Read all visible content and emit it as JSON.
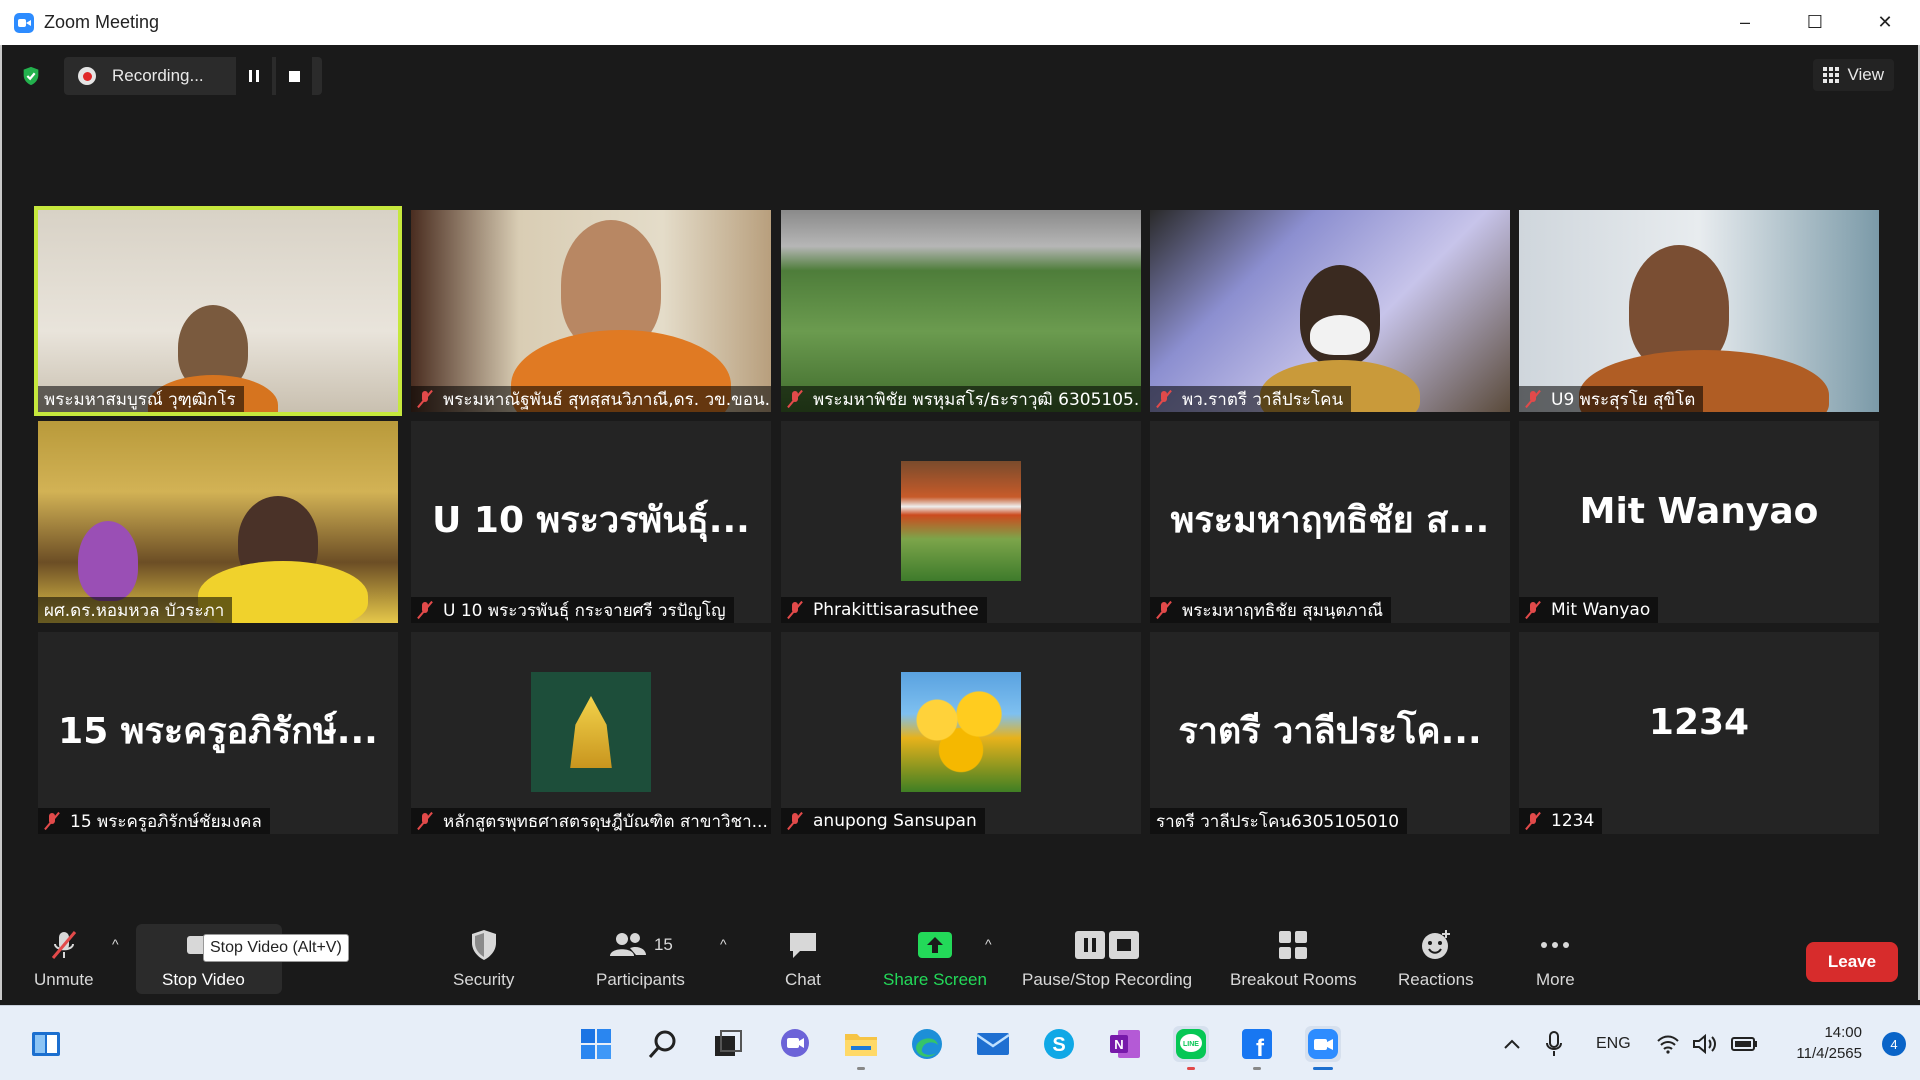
{
  "window": {
    "title": "Zoom Meeting",
    "controls": [
      "–",
      "☐",
      "✕"
    ]
  },
  "meeting_bar": {
    "recording_label": "Recording...",
    "view_label": "View"
  },
  "tiles": [
    {
      "big": "",
      "name": "พระมหาสมบูรณ์ วุฑฺฒิกโร",
      "muted": false
    },
    {
      "big": "",
      "name": "พระมหาณัฐพันธ์ สุทสฺสนวิภาณี,ดร. วข.ขอน...",
      "muted": true
    },
    {
      "big": "",
      "name": "พระมหาพิชัย พรหุมสโร/ธะราวุฒิ 6305105...",
      "muted": true
    },
    {
      "big": "",
      "name": "พว.ราตรี วาลีประโคน",
      "muted": true
    },
    {
      "big": "",
      "name": "U9 พระสุรโย สุขิโต",
      "muted": true
    },
    {
      "big": "",
      "name": "ผศ.ดร.หอมหวล บัวระภา",
      "muted": false
    },
    {
      "big": "U 10 พระวรพันธุ์...",
      "name": "U 10 พระวรพันธุ์ กระจายศรี วรปัญโญ",
      "muted": true
    },
    {
      "big": "",
      "name": "Phrakittisarasuthee",
      "muted": true
    },
    {
      "big": "พระมหาฤทธิชัย ส...",
      "name": "พระมหาฤทธิชัย สุมนฺตภาณี",
      "muted": true
    },
    {
      "big": "Mit Wanyao",
      "name": "Mit Wanyao",
      "muted": true
    },
    {
      "big": "15 พระครูอภิรักษ์...",
      "name": "15 พระครูอภิรักษ์ชัยมงคล",
      "muted": true
    },
    {
      "big": "",
      "name": "หลักสูตรพุทธศาสตรดุษฎีบัณฑิต สาขาวิชา...",
      "muted": true
    },
    {
      "big": "",
      "name": "anupong Sansupan",
      "muted": true
    },
    {
      "big": "ราตรี วาลีประโค...",
      "name": "ราตรี วาลีประโคน6305105010",
      "muted": false
    },
    {
      "big": "1234",
      "name": "1234",
      "muted": true
    }
  ],
  "toolbar": {
    "unmute": "Unmute",
    "stop_video": "Stop Video",
    "tooltip": "Stop Video (Alt+V)",
    "security": "Security",
    "participants": "Participants",
    "participants_count": "15",
    "chat": "Chat",
    "share_screen": "Share Screen",
    "pause_stop_recording": "Pause/Stop Recording",
    "breakout_rooms": "Breakout Rooms",
    "reactions": "Reactions",
    "more": "More",
    "leave": "Leave"
  },
  "taskbar": {
    "language": "ENG",
    "time": "14:00",
    "date": "11/4/2565",
    "notifications": "4",
    "apps": [
      "start",
      "search",
      "task-view",
      "teams-chat",
      "file-explorer",
      "edge",
      "mail",
      "skype",
      "onenote",
      "line",
      "facebook",
      "zoom"
    ]
  },
  "colors": {
    "active_speaker": "#c6e83d",
    "leave": "#d72c2c",
    "share_screen": "#23d959",
    "muted": "#e24a4a"
  }
}
